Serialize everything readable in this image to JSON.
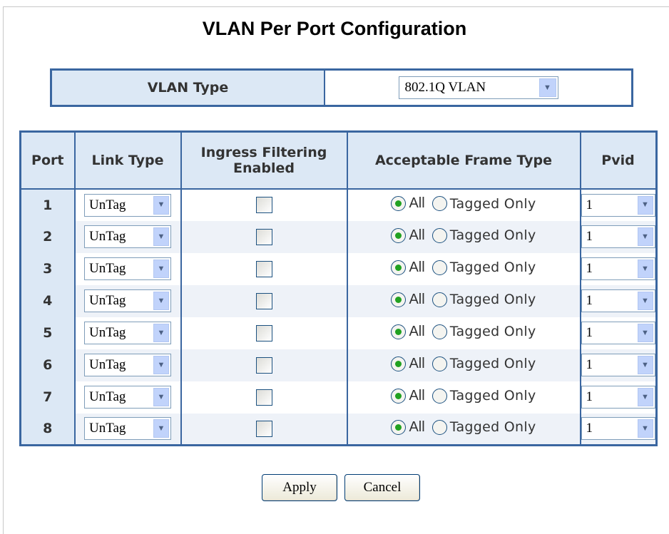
{
  "page": {
    "title": "VLAN Per Port Configuration"
  },
  "vlan_type": {
    "label": "VLAN Type",
    "value": "802.1Q VLAN"
  },
  "table": {
    "headers": {
      "port": "Port",
      "link_type": "Link Type",
      "ingress_line1": "Ingress Filtering",
      "ingress_line2": "Enabled",
      "frame_type": "Acceptable Frame Type",
      "pvid": "Pvid"
    },
    "rows": [
      {
        "port": "1",
        "link_type": "UnTag",
        "ingress": false,
        "frame": "All",
        "pvid": "1"
      },
      {
        "port": "2",
        "link_type": "UnTag",
        "ingress": false,
        "frame": "All",
        "pvid": "1"
      },
      {
        "port": "3",
        "link_type": "UnTag",
        "ingress": false,
        "frame": "All",
        "pvid": "1"
      },
      {
        "port": "4",
        "link_type": "UnTag",
        "ingress": false,
        "frame": "All",
        "pvid": "1"
      },
      {
        "port": "5",
        "link_type": "UnTag",
        "ingress": false,
        "frame": "All",
        "pvid": "1"
      },
      {
        "port": "6",
        "link_type": "UnTag",
        "ingress": false,
        "frame": "All",
        "pvid": "1"
      },
      {
        "port": "7",
        "link_type": "UnTag",
        "ingress": false,
        "frame": "All",
        "pvid": "1"
      },
      {
        "port": "8",
        "link_type": "UnTag",
        "ingress": false,
        "frame": "All",
        "pvid": "1"
      }
    ],
    "frame_options": {
      "all": "All",
      "tagged": "Tagged Only"
    }
  },
  "buttons": {
    "apply": "Apply",
    "cancel": "Cancel"
  },
  "icons": {
    "dropdown": "chevron-down-icon",
    "checkbox": "checkbox-icon",
    "radio": "radio-icon"
  },
  "colors": {
    "border": "#3a66a0",
    "header_bg": "#dce8f5",
    "row_alt_bg": "#eef2f8",
    "radio_dot": "#21a121"
  }
}
